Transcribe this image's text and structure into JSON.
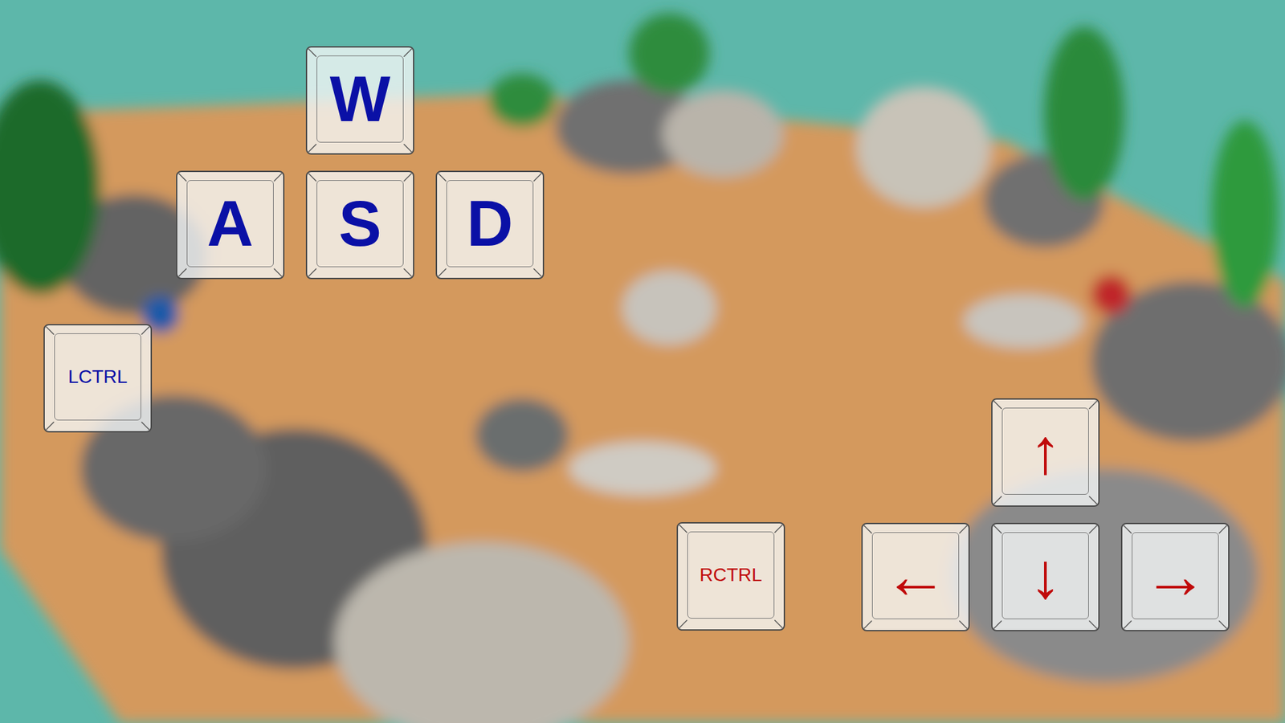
{
  "player_one": {
    "color": "#0a10a6",
    "movement_keys": {
      "up": "W",
      "left": "A",
      "down": "S",
      "right": "D"
    },
    "action_key": "LCTRL"
  },
  "player_two": {
    "color": "#c00a0a",
    "movement_keys": {
      "up": "↑",
      "left": "←",
      "down": "↓",
      "right": "→"
    },
    "action_key": "RCTRL"
  }
}
